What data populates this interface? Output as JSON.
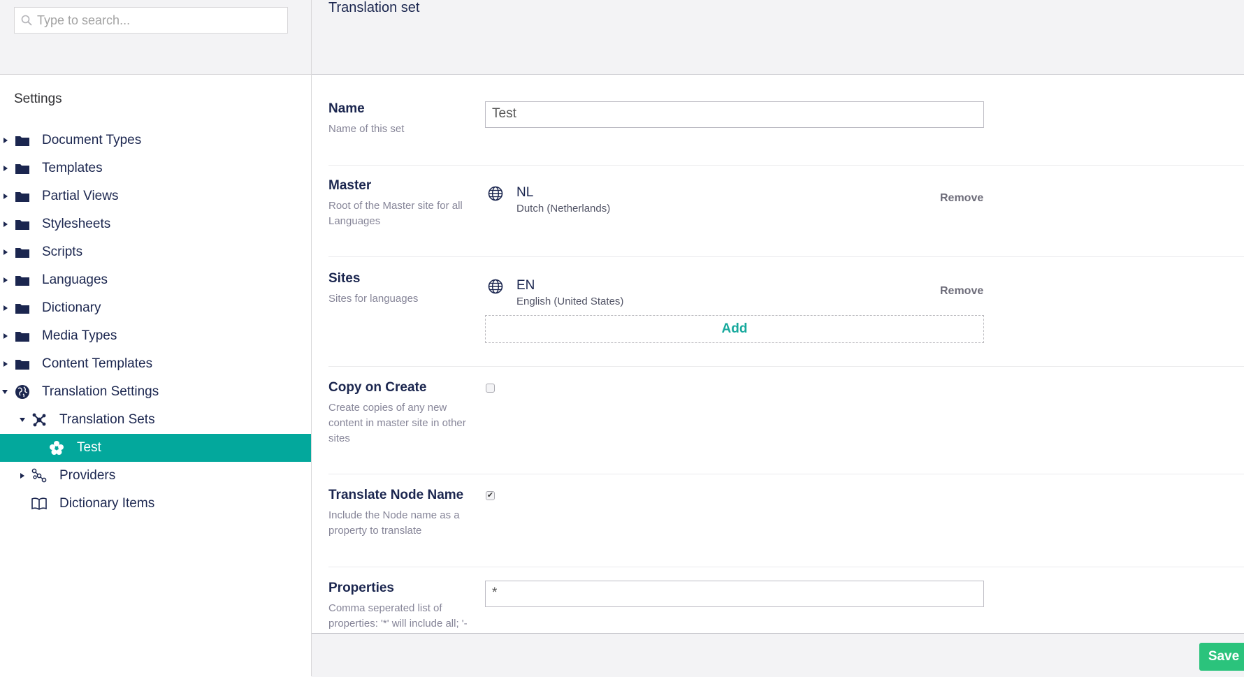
{
  "search": {
    "placeholder": "Type to search..."
  },
  "sidebar": {
    "title": "Settings",
    "items": [
      {
        "label": "Document Types",
        "icon": "folder-icon"
      },
      {
        "label": "Templates",
        "icon": "folder-icon"
      },
      {
        "label": "Partial Views",
        "icon": "folder-icon"
      },
      {
        "label": "Stylesheets",
        "icon": "folder-icon"
      },
      {
        "label": "Scripts",
        "icon": "folder-icon"
      },
      {
        "label": "Languages",
        "icon": "folder-icon"
      },
      {
        "label": "Dictionary",
        "icon": "folder-icon"
      },
      {
        "label": "Media Types",
        "icon": "folder-icon"
      },
      {
        "label": "Content Templates",
        "icon": "folder-icon"
      },
      {
        "label": "Translation Settings",
        "icon": "globe-icon"
      },
      {
        "label": "Translation Sets",
        "icon": "network-icon"
      },
      {
        "label": "Test",
        "icon": "flower-icon"
      },
      {
        "label": "Providers",
        "icon": "links-icon"
      },
      {
        "label": "Dictionary Items",
        "icon": "book-icon"
      }
    ]
  },
  "header": {
    "title": "Translation set"
  },
  "form": {
    "name": {
      "label": "Name",
      "description": "Name of this set",
      "value": "Test"
    },
    "master": {
      "label": "Master",
      "description": "Root of the Master site for all Languages",
      "site": {
        "code": "NL",
        "name": "Dutch (Netherlands)"
      },
      "remove_label": "Remove"
    },
    "sites": {
      "label": "Sites",
      "description": "Sites for languages",
      "site": {
        "code": "EN",
        "name": "English (United States)"
      },
      "remove_label": "Remove",
      "add_label": "Add"
    },
    "copy_on_create": {
      "label": "Copy on Create",
      "description": "Create copies of any new content in master site in other sites",
      "checked": false
    },
    "translate_node_name": {
      "label": "Translate Node Name",
      "description": "Include the Node name as a property to translate",
      "checked": true,
      "check_glyph": "✔"
    },
    "properties": {
      "label": "Properties",
      "description": "Comma seperated list of properties: '*' will include all; '-",
      "value": "*"
    }
  },
  "footer": {
    "save_label": "Save"
  },
  "colors": {
    "accent": "#03a89c",
    "save": "#2bc37c",
    "header_bg": "#f3f3f5"
  }
}
